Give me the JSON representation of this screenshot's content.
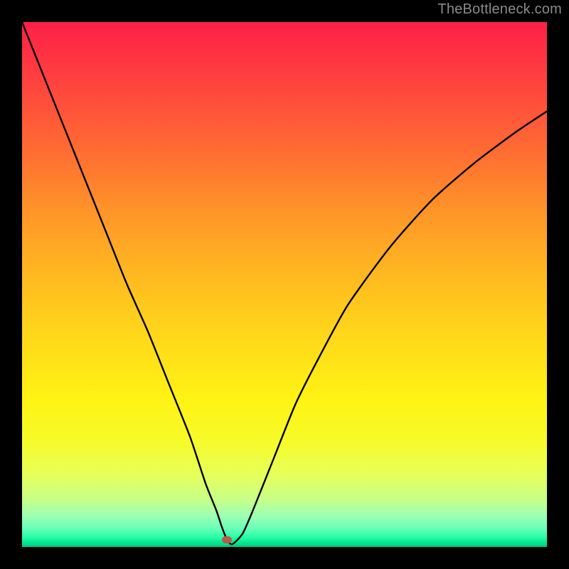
{
  "watermark": "TheBottleneck.com",
  "chart_data": {
    "type": "line",
    "title": "",
    "xlabel": "",
    "ylabel": "",
    "xlim": [
      0,
      100
    ],
    "ylim": [
      0,
      100
    ],
    "x": [
      0,
      4,
      8,
      12,
      16,
      20,
      24,
      28,
      32,
      35,
      37,
      38,
      39,
      40,
      42,
      44,
      48,
      52,
      56,
      62,
      70,
      78,
      86,
      94,
      100
    ],
    "values": [
      100,
      90,
      80,
      70,
      60,
      50,
      41,
      31,
      21,
      12,
      7,
      4,
      1.5,
      0.5,
      2.5,
      7,
      17,
      27,
      35,
      46,
      57,
      66,
      73,
      79,
      83
    ],
    "marker": {
      "x": 39,
      "y": 1.3
    },
    "gradient_stops": [
      {
        "pct": 0,
        "color": "#ff1f47"
      },
      {
        "pct": 50,
        "color": "#ffc71e"
      },
      {
        "pct": 80,
        "color": "#f6fb2a"
      },
      {
        "pct": 100,
        "color": "#00c882"
      }
    ]
  }
}
